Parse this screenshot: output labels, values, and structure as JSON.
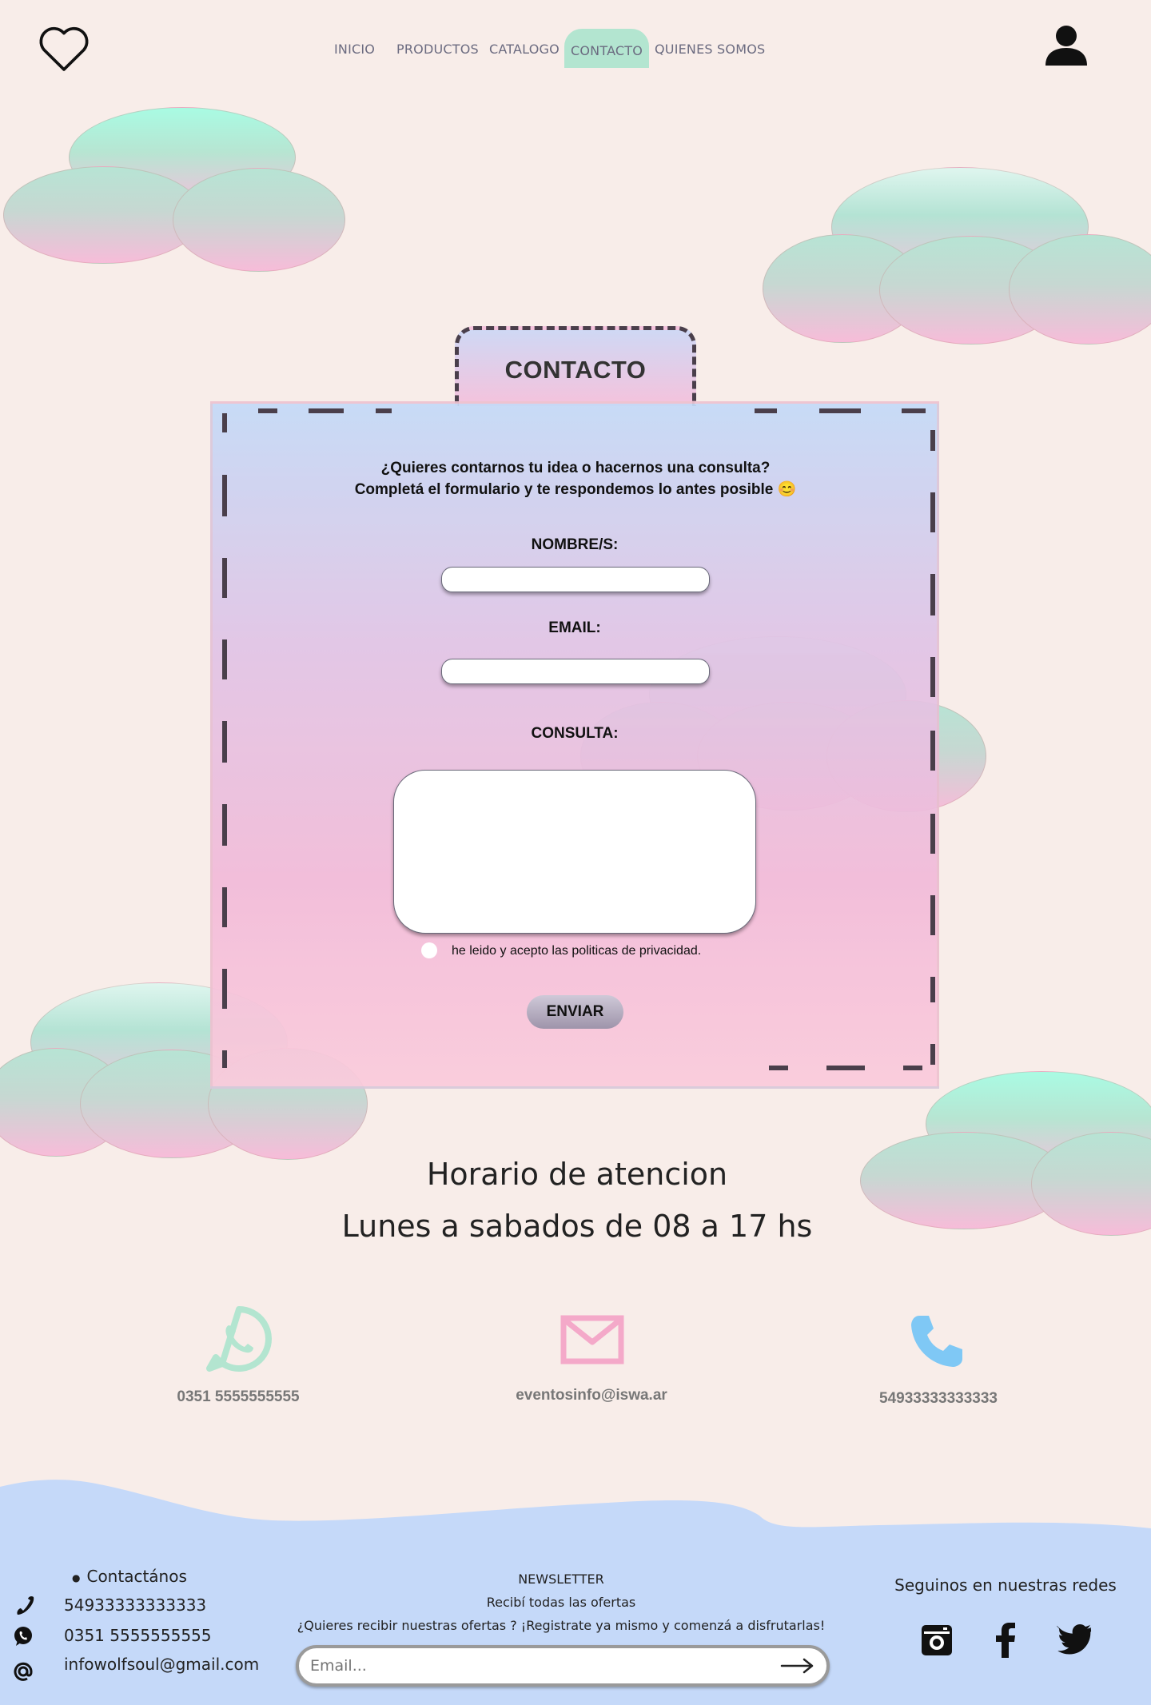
{
  "header": {
    "nav": [
      "INICIO",
      "PRODUCTOS",
      "CATALOGO",
      "CONTACTO",
      "QUIENES SOMOS"
    ],
    "active": "CONTACTO"
  },
  "form": {
    "tab_title": "CONTACTO",
    "intro_line1": "¿Quieres contarnos tu idea o hacernos una consulta?",
    "intro_line2": "Completá el formulario y te respondemos lo antes posible 😊",
    "name_label": "NOMBRE/S:",
    "email_label": "EMAIL:",
    "query_label": "CONSULTA:",
    "privacy_text": "he leido y acepto las politicas de privacidad.",
    "submit": "ENVIAR"
  },
  "hours": {
    "title": "Horario de atencion",
    "schedule": "Lunes a sabados de 08 a 17 hs"
  },
  "contacts": {
    "whatsapp": "0351 5555555555",
    "email": "eventosinfo@iswa.ar",
    "phone": "54933333333333"
  },
  "footer": {
    "contact_heading": "Contactános",
    "phone": "54933333333333",
    "whatsapp": "0351 5555555555",
    "email": "infowolfsoul@gmail.com",
    "newsletter_title": "NEWSLETTER",
    "newsletter_sub": "Recibí todas las ofertas",
    "newsletter_desc": "¿Quieres recibir nuestras ofertas ? ¡Registrate ya mismo y comenzá a disfrutarlas!",
    "email_placeholder": "Email...",
    "social_heading": "Seguinos en nuestras redes"
  },
  "colors": {
    "background": "#f8ede9",
    "footer": "#c5d9f9",
    "active_tab": "#b3e5d0",
    "whatsapp_icon": "#b3e5d0",
    "mail_icon": "#f4a9c9",
    "phone_icon": "#7fc8f5"
  }
}
